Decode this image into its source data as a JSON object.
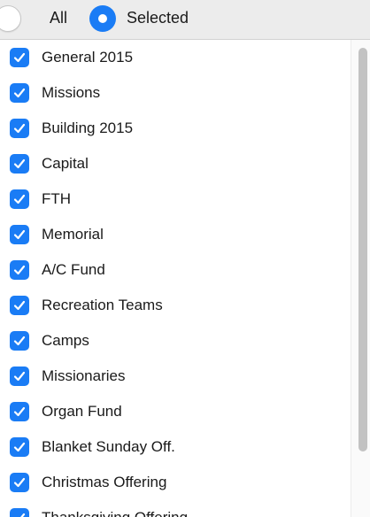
{
  "filter": {
    "all_label": "All",
    "selected_label": "Selected",
    "active_option": "Selected"
  },
  "funds": {
    "items": [
      {
        "label": "General 2015",
        "checked": true
      },
      {
        "label": "Missions",
        "checked": true
      },
      {
        "label": "Building 2015",
        "checked": true
      },
      {
        "label": "Capital",
        "checked": true
      },
      {
        "label": "FTH",
        "checked": true
      },
      {
        "label": "Memorial",
        "checked": true
      },
      {
        "label": "A/C Fund",
        "checked": true
      },
      {
        "label": "Recreation Teams",
        "checked": true
      },
      {
        "label": "Camps",
        "checked": true
      },
      {
        "label": "Missionaries",
        "checked": true
      },
      {
        "label": "Organ Fund",
        "checked": true
      },
      {
        "label": "Blanket Sunday Off.",
        "checked": true
      },
      {
        "label": "Christmas Offering",
        "checked": true
      },
      {
        "label": "Thanksgiving Offering",
        "checked": true
      }
    ]
  },
  "colors": {
    "accent": "#1a7cf5",
    "header_bg": "#ececec",
    "scroll_thumb": "#c2c2c2"
  }
}
